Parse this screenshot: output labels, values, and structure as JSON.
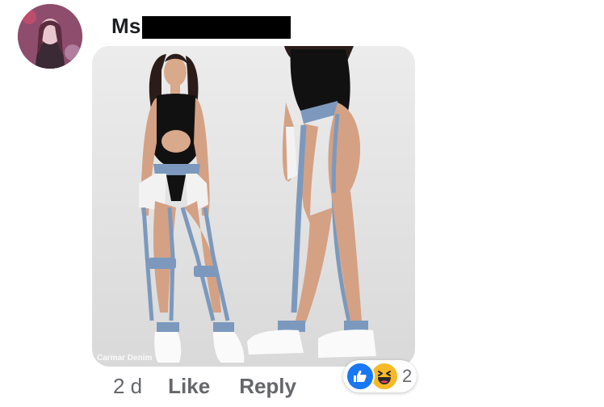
{
  "comment": {
    "author_name_visible": "Ms",
    "author_name_redacted": true,
    "avatar": "avatar-photo",
    "attachment": {
      "type": "photo",
      "watermark": "Carmar Denim"
    },
    "timestamp": "2 d",
    "actions": {
      "like_label": "Like",
      "reply_label": "Reply"
    },
    "reactions": {
      "icons": [
        "like-icon",
        "haha-icon"
      ],
      "count": "2"
    }
  },
  "colors": {
    "like_blue": "#1877f2",
    "haha_yellow": "#f7b928",
    "meta_gray": "#65676b",
    "name_dark": "#1c1e21"
  }
}
